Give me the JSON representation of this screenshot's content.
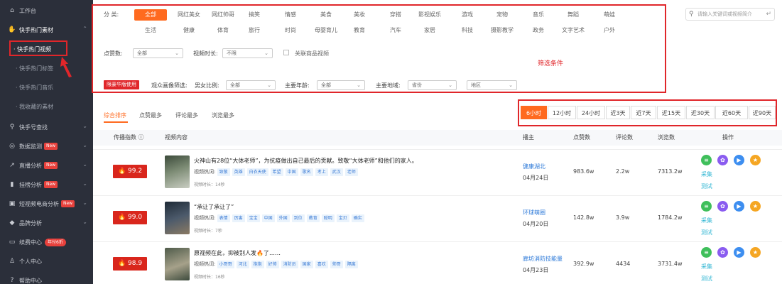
{
  "sidebar": {
    "items": [
      {
        "label": "工作台",
        "icon": "home-icon"
      },
      {
        "label": "快手热门素材",
        "icon": "thumb-icon"
      },
      {
        "label": "快手号查找",
        "icon": "search-icon"
      },
      {
        "label": "数据监测",
        "icon": "monitor-icon",
        "badge": "New"
      },
      {
        "label": "直播分析",
        "icon": "line-chart-icon",
        "badge": "New"
      },
      {
        "label": "挂榜分析",
        "icon": "bar-chart-icon",
        "badge": "New"
      },
      {
        "label": "短视频电商分析",
        "icon": "shop-icon",
        "badge": "New"
      },
      {
        "label": "品牌分析",
        "icon": "diamond-icon"
      },
      {
        "label": "续费中心",
        "icon": "card-icon",
        "badge": "年付6折"
      },
      {
        "label": "个人中心",
        "icon": "user-icon"
      },
      {
        "label": "帮助中心",
        "icon": "help-icon"
      }
    ],
    "sub_items": [
      "· 快手热门视频",
      "· 快手热门标签",
      "· 快手热门音乐",
      "· 我收藏的素材"
    ]
  },
  "search": {
    "placeholder": "请输入关键词或视频简介"
  },
  "filters": {
    "category_label": "分  类:",
    "categories_row1": [
      "全部",
      "网红美女",
      "网红帅哥",
      "搞笑",
      "情感",
      "美食",
      "美妆",
      "穿搭",
      "影视娱乐",
      "游戏",
      "宠物",
      "音乐",
      "舞蹈",
      "萌娃"
    ],
    "categories_row2": [
      "生活",
      "健康",
      "体育",
      "旅行",
      "时尚",
      "母婴育儿",
      "教育",
      "汽车",
      "家居",
      "科技",
      "摄影教学",
      "政务",
      "文字艺术",
      "户外"
    ],
    "likes_label": "点赞数:",
    "likes_value": "全部",
    "duration_label": "视频时长:",
    "duration_value": "不限",
    "product_label": "关联商品视频",
    "hd_button": "限豪华版使用",
    "audience_label": "观众画像筛选:",
    "gender_label": "男女比例:",
    "gender_value": "全部",
    "age_label": "主要年龄:",
    "age_value": "全部",
    "region_label": "主要地域:",
    "province_value": "省份",
    "city_value": "地区",
    "annotation": "筛选条件"
  },
  "sort_tabs": [
    "综合排序",
    "点赞最多",
    "评论最多",
    "浏览最多"
  ],
  "time_tabs": [
    "6小时",
    "12小时",
    "24小时",
    "近3天",
    "近7天",
    "近15天",
    "近30天",
    "近60天",
    "近90天"
  ],
  "table": {
    "headers": [
      "传播指数",
      "视频内容",
      "播主",
      "点赞数",
      "评论数",
      "浏览数",
      "操作"
    ],
    "hot_prefix": "视频热词:",
    "ops": [
      "采集",
      "测试"
    ],
    "rows": [
      {
        "score": "99.2",
        "title": "火神山有28位“大体老师”，为抗疫做出自己最后的贡献。致敬“大体老师”和他们的家人。",
        "tags": [
          "致敬",
          "英雄",
          "白衣天使",
          "希望",
          "中国",
          "歌名",
          "考上",
          "武汉",
          "老师"
        ],
        "duration": "视频时长：14秒",
        "author": "健康湖北",
        "date": "04月24日",
        "likes": "983.6w",
        "comments": "2.2w",
        "views": "7313.2w"
      },
      {
        "score": "99.0",
        "title": "“承让了承让了”",
        "tags": [
          "表情",
          "厉害",
          "宝宝",
          "中国",
          "外国",
          "到位",
          "教育",
          "聪明",
          "宝贝",
          "确实"
        ],
        "duration": "视频时长：7秒",
        "author": "环球萌圈",
        "date": "04月20日",
        "likes": "142.8w",
        "comments": "3.9w",
        "views": "1784.2w"
      },
      {
        "score": "98.9",
        "title": "原视频在此，抑被别人发🔥了……",
        "tags": [
          "小哥哥",
          "河北",
          "抱抱",
          "好帅",
          "消防员",
          "国家",
          "喜欢",
          "帅哥",
          "隔离"
        ],
        "duration": "视频时长：16秒",
        "author": "廊坊消防技能量",
        "date": "04月23日",
        "likes": "392.9w",
        "comments": "4434",
        "views": "3731.4w"
      }
    ]
  },
  "colors": {
    "accent": "#ff6a1f",
    "highlight_red": "#e0262a",
    "sidebar_bg": "#2b2f3a",
    "score_red": "#d9261c"
  }
}
